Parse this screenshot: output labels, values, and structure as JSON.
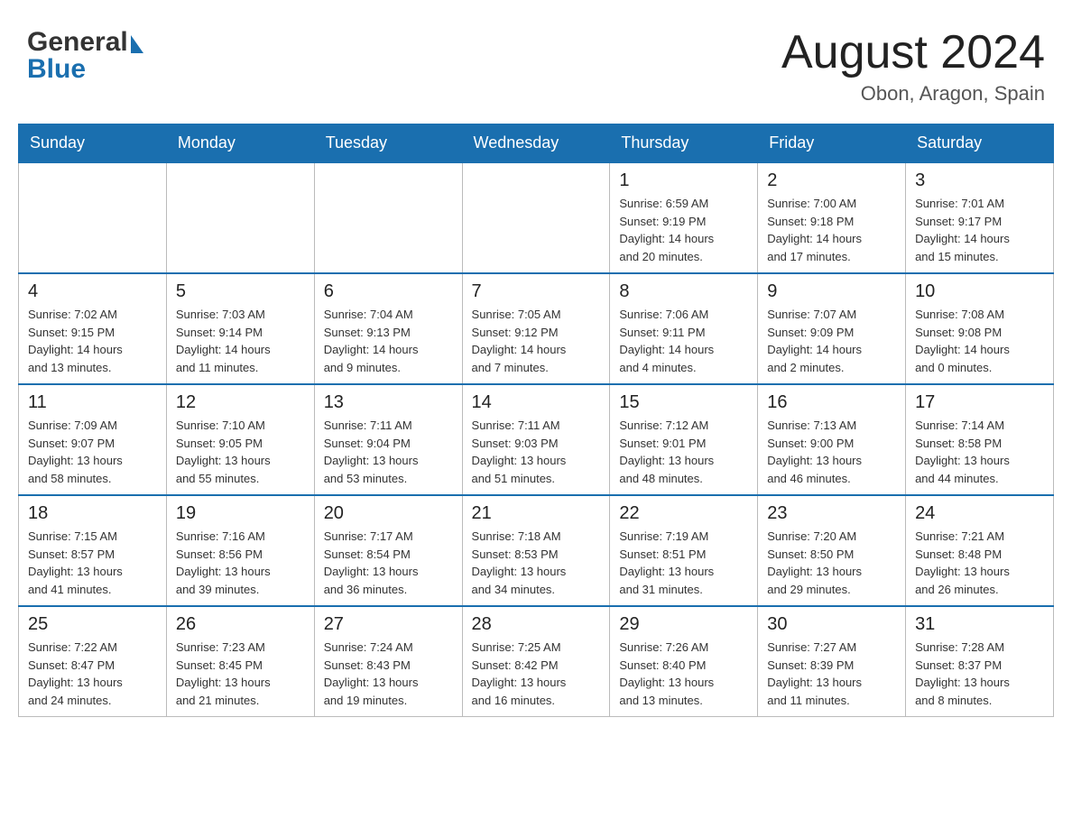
{
  "header": {
    "logo_general": "General",
    "logo_blue": "Blue",
    "month_year": "August 2024",
    "location": "Obon, Aragon, Spain"
  },
  "weekdays": [
    "Sunday",
    "Monday",
    "Tuesday",
    "Wednesday",
    "Thursday",
    "Friday",
    "Saturday"
  ],
  "weeks": [
    [
      {
        "day": "",
        "info": ""
      },
      {
        "day": "",
        "info": ""
      },
      {
        "day": "",
        "info": ""
      },
      {
        "day": "",
        "info": ""
      },
      {
        "day": "1",
        "info": "Sunrise: 6:59 AM\nSunset: 9:19 PM\nDaylight: 14 hours\nand 20 minutes."
      },
      {
        "day": "2",
        "info": "Sunrise: 7:00 AM\nSunset: 9:18 PM\nDaylight: 14 hours\nand 17 minutes."
      },
      {
        "day": "3",
        "info": "Sunrise: 7:01 AM\nSunset: 9:17 PM\nDaylight: 14 hours\nand 15 minutes."
      }
    ],
    [
      {
        "day": "4",
        "info": "Sunrise: 7:02 AM\nSunset: 9:15 PM\nDaylight: 14 hours\nand 13 minutes."
      },
      {
        "day": "5",
        "info": "Sunrise: 7:03 AM\nSunset: 9:14 PM\nDaylight: 14 hours\nand 11 minutes."
      },
      {
        "day": "6",
        "info": "Sunrise: 7:04 AM\nSunset: 9:13 PM\nDaylight: 14 hours\nand 9 minutes."
      },
      {
        "day": "7",
        "info": "Sunrise: 7:05 AM\nSunset: 9:12 PM\nDaylight: 14 hours\nand 7 minutes."
      },
      {
        "day": "8",
        "info": "Sunrise: 7:06 AM\nSunset: 9:11 PM\nDaylight: 14 hours\nand 4 minutes."
      },
      {
        "day": "9",
        "info": "Sunrise: 7:07 AM\nSunset: 9:09 PM\nDaylight: 14 hours\nand 2 minutes."
      },
      {
        "day": "10",
        "info": "Sunrise: 7:08 AM\nSunset: 9:08 PM\nDaylight: 14 hours\nand 0 minutes."
      }
    ],
    [
      {
        "day": "11",
        "info": "Sunrise: 7:09 AM\nSunset: 9:07 PM\nDaylight: 13 hours\nand 58 minutes."
      },
      {
        "day": "12",
        "info": "Sunrise: 7:10 AM\nSunset: 9:05 PM\nDaylight: 13 hours\nand 55 minutes."
      },
      {
        "day": "13",
        "info": "Sunrise: 7:11 AM\nSunset: 9:04 PM\nDaylight: 13 hours\nand 53 minutes."
      },
      {
        "day": "14",
        "info": "Sunrise: 7:11 AM\nSunset: 9:03 PM\nDaylight: 13 hours\nand 51 minutes."
      },
      {
        "day": "15",
        "info": "Sunrise: 7:12 AM\nSunset: 9:01 PM\nDaylight: 13 hours\nand 48 minutes."
      },
      {
        "day": "16",
        "info": "Sunrise: 7:13 AM\nSunset: 9:00 PM\nDaylight: 13 hours\nand 46 minutes."
      },
      {
        "day": "17",
        "info": "Sunrise: 7:14 AM\nSunset: 8:58 PM\nDaylight: 13 hours\nand 44 minutes."
      }
    ],
    [
      {
        "day": "18",
        "info": "Sunrise: 7:15 AM\nSunset: 8:57 PM\nDaylight: 13 hours\nand 41 minutes."
      },
      {
        "day": "19",
        "info": "Sunrise: 7:16 AM\nSunset: 8:56 PM\nDaylight: 13 hours\nand 39 minutes."
      },
      {
        "day": "20",
        "info": "Sunrise: 7:17 AM\nSunset: 8:54 PM\nDaylight: 13 hours\nand 36 minutes."
      },
      {
        "day": "21",
        "info": "Sunrise: 7:18 AM\nSunset: 8:53 PM\nDaylight: 13 hours\nand 34 minutes."
      },
      {
        "day": "22",
        "info": "Sunrise: 7:19 AM\nSunset: 8:51 PM\nDaylight: 13 hours\nand 31 minutes."
      },
      {
        "day": "23",
        "info": "Sunrise: 7:20 AM\nSunset: 8:50 PM\nDaylight: 13 hours\nand 29 minutes."
      },
      {
        "day": "24",
        "info": "Sunrise: 7:21 AM\nSunset: 8:48 PM\nDaylight: 13 hours\nand 26 minutes."
      }
    ],
    [
      {
        "day": "25",
        "info": "Sunrise: 7:22 AM\nSunset: 8:47 PM\nDaylight: 13 hours\nand 24 minutes."
      },
      {
        "day": "26",
        "info": "Sunrise: 7:23 AM\nSunset: 8:45 PM\nDaylight: 13 hours\nand 21 minutes."
      },
      {
        "day": "27",
        "info": "Sunrise: 7:24 AM\nSunset: 8:43 PM\nDaylight: 13 hours\nand 19 minutes."
      },
      {
        "day": "28",
        "info": "Sunrise: 7:25 AM\nSunset: 8:42 PM\nDaylight: 13 hours\nand 16 minutes."
      },
      {
        "day": "29",
        "info": "Sunrise: 7:26 AM\nSunset: 8:40 PM\nDaylight: 13 hours\nand 13 minutes."
      },
      {
        "day": "30",
        "info": "Sunrise: 7:27 AM\nSunset: 8:39 PM\nDaylight: 13 hours\nand 11 minutes."
      },
      {
        "day": "31",
        "info": "Sunrise: 7:28 AM\nSunset: 8:37 PM\nDaylight: 13 hours\nand 8 minutes."
      }
    ]
  ]
}
